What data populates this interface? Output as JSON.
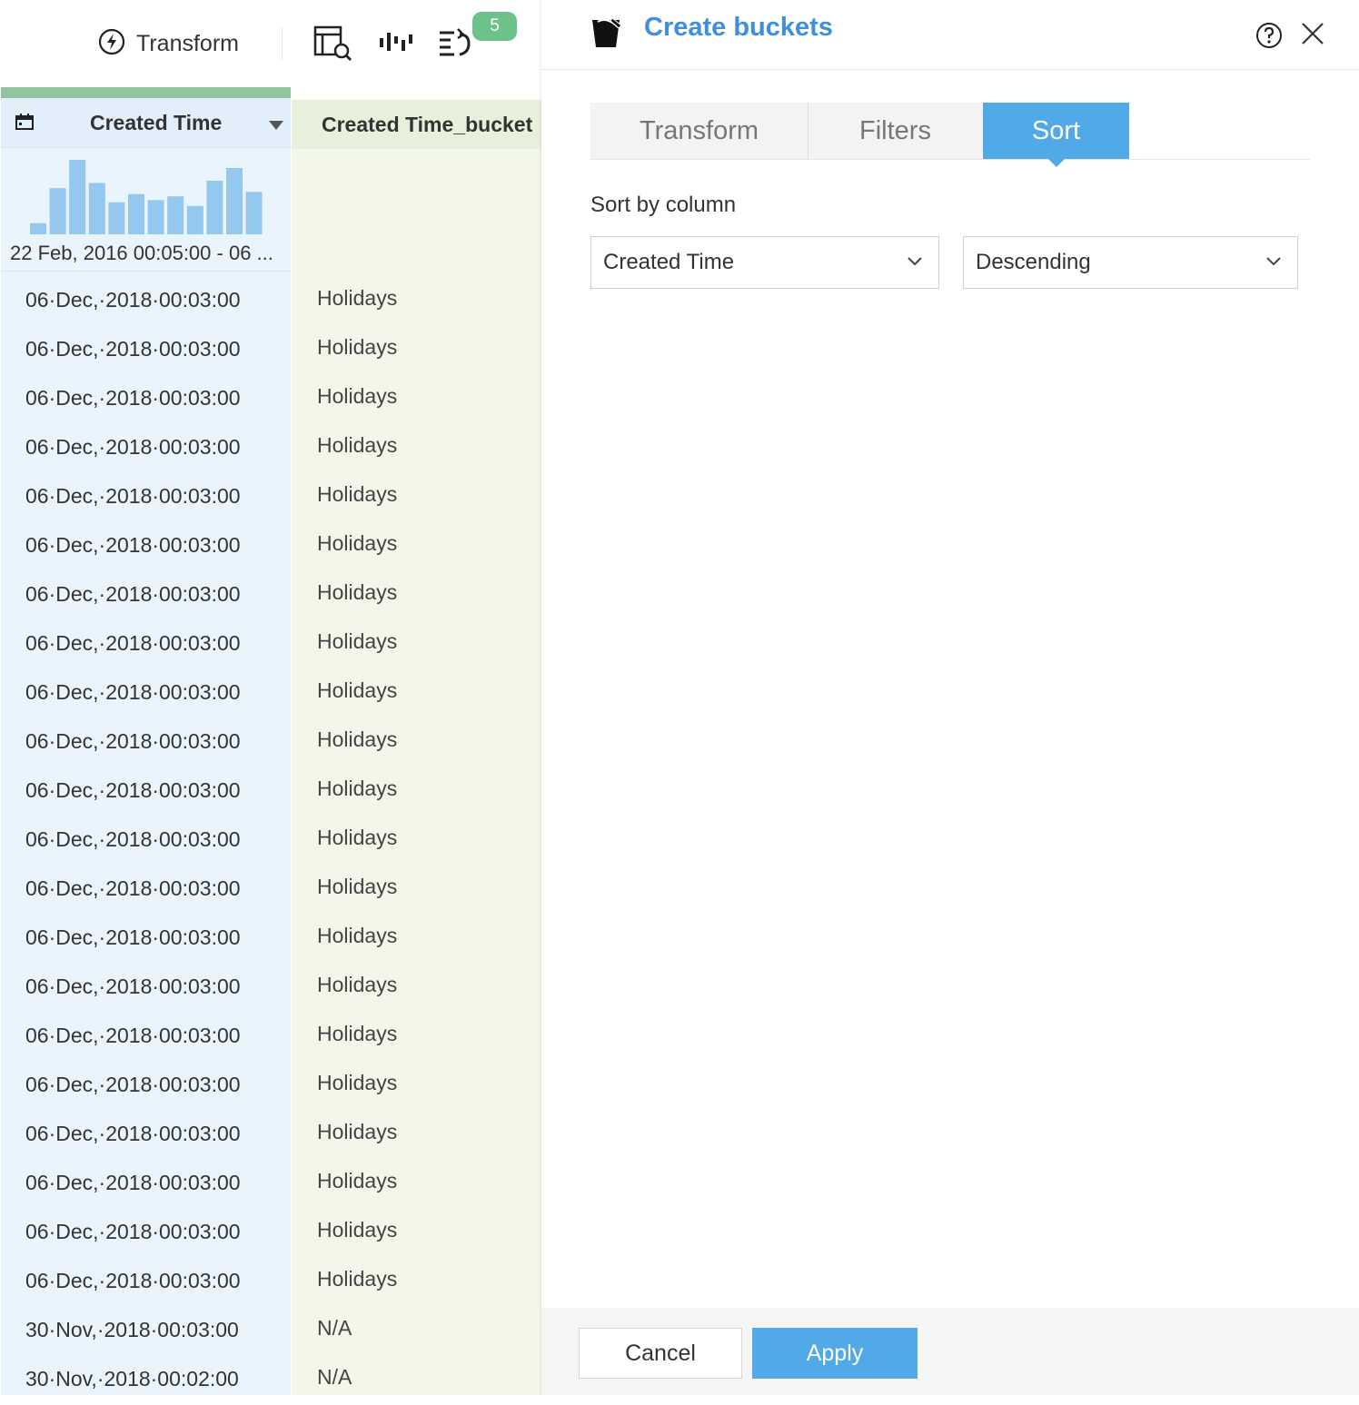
{
  "toolbar": {
    "transform_label": "Transform",
    "badge_count": "5",
    "icons": [
      "lightning-icon",
      "table-preview-icon",
      "histogram-icon",
      "undo-steps-icon"
    ]
  },
  "grid": {
    "col1": {
      "header": "Created Time",
      "range_label": "22 Feb, 2016 00:05:00 - 06 ...",
      "histogram_values": [
        0.15,
        0.62,
        1.0,
        0.69,
        0.43,
        0.54,
        0.46,
        0.51,
        0.38,
        0.72,
        0.89,
        0.57
      ],
      "histogram_color": "#94c8ee"
    },
    "col2": {
      "header": "Created Time_bucket"
    },
    "rows": [
      {
        "time": "06·Dec,·2018·00:03:00",
        "bucket": "Holidays"
      },
      {
        "time": "06·Dec,·2018·00:03:00",
        "bucket": "Holidays"
      },
      {
        "time": "06·Dec,·2018·00:03:00",
        "bucket": "Holidays"
      },
      {
        "time": "06·Dec,·2018·00:03:00",
        "bucket": "Holidays"
      },
      {
        "time": "06·Dec,·2018·00:03:00",
        "bucket": "Holidays"
      },
      {
        "time": "06·Dec,·2018·00:03:00",
        "bucket": "Holidays"
      },
      {
        "time": "06·Dec,·2018·00:03:00",
        "bucket": "Holidays"
      },
      {
        "time": "06·Dec,·2018·00:03:00",
        "bucket": "Holidays"
      },
      {
        "time": "06·Dec,·2018·00:03:00",
        "bucket": "Holidays"
      },
      {
        "time": "06·Dec,·2018·00:03:00",
        "bucket": "Holidays"
      },
      {
        "time": "06·Dec,·2018·00:03:00",
        "bucket": "Holidays"
      },
      {
        "time": "06·Dec,·2018·00:03:00",
        "bucket": "Holidays"
      },
      {
        "time": "06·Dec,·2018·00:03:00",
        "bucket": "Holidays"
      },
      {
        "time": "06·Dec,·2018·00:03:00",
        "bucket": "Holidays"
      },
      {
        "time": "06·Dec,·2018·00:03:00",
        "bucket": "Holidays"
      },
      {
        "time": "06·Dec,·2018·00:03:00",
        "bucket": "Holidays"
      },
      {
        "time": "06·Dec,·2018·00:03:00",
        "bucket": "Holidays"
      },
      {
        "time": "06·Dec,·2018·00:03:00",
        "bucket": "Holidays"
      },
      {
        "time": "06·Dec,·2018·00:03:00",
        "bucket": "Holidays"
      },
      {
        "time": "06·Dec,·2018·00:03:00",
        "bucket": "Holidays"
      },
      {
        "time": "06·Dec,·2018·00:03:00",
        "bucket": "Holidays"
      },
      {
        "time": "30·Nov,·2018·00:03:00",
        "bucket": "N/A"
      },
      {
        "time": "30·Nov,·2018·00:02:00",
        "bucket": "N/A"
      }
    ]
  },
  "panel": {
    "title": "Create buckets",
    "tabs": [
      "Transform",
      "Filters",
      "Sort"
    ],
    "active_tab": "Sort",
    "sort_label": "Sort by column",
    "sort_column": "Created Time",
    "sort_order": "Descending",
    "cancel_label": "Cancel",
    "apply_label": "Apply",
    "accent_color": "#52a9e8",
    "title_color": "#3e8fde"
  }
}
